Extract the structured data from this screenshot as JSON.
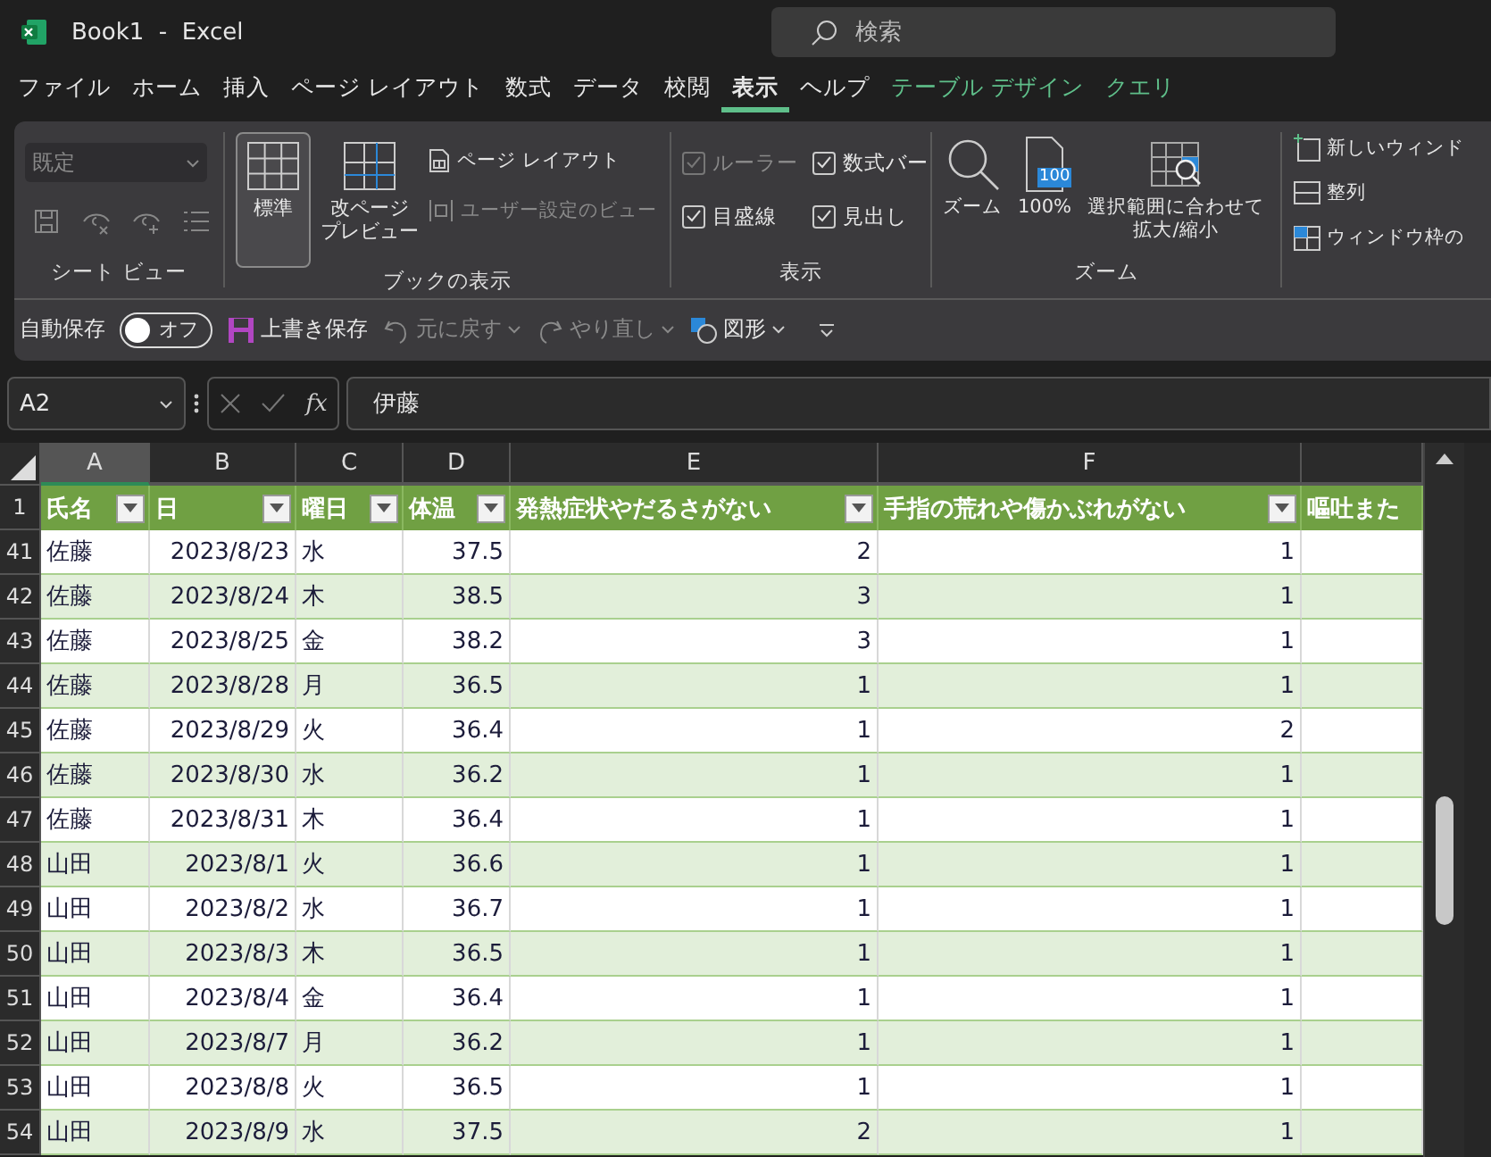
{
  "window": {
    "title": "Book1  -  Excel",
    "search_placeholder": "検索"
  },
  "menu_tabs": [
    {
      "label": "ファイル",
      "selected": false,
      "contextual": false
    },
    {
      "label": "ホーム",
      "selected": false,
      "contextual": false
    },
    {
      "label": "挿入",
      "selected": false,
      "contextual": false
    },
    {
      "label": "ページ レイアウト",
      "selected": false,
      "contextual": false
    },
    {
      "label": "数式",
      "selected": false,
      "contextual": false
    },
    {
      "label": "データ",
      "selected": false,
      "contextual": false
    },
    {
      "label": "校閲",
      "selected": false,
      "contextual": false
    },
    {
      "label": "表示",
      "selected": true,
      "contextual": false
    },
    {
      "label": "ヘルプ",
      "selected": false,
      "contextual": false
    },
    {
      "label": "テーブル デザイン",
      "selected": false,
      "contextual": true
    },
    {
      "label": "クエリ",
      "selected": false,
      "contextual": true
    }
  ],
  "ribbon": {
    "sheet_view": {
      "label": "シート ビュー",
      "dropdown": "既定"
    },
    "workbook_views": {
      "label": "ブックの表示",
      "large": [
        {
          "lines": [
            "標準"
          ],
          "selected": true
        },
        {
          "lines": [
            "改ページ",
            "プレビュー"
          ],
          "selected": false
        }
      ],
      "small": [
        {
          "label": "ページ レイアウト",
          "disabled": false
        },
        {
          "label": "ユーザー設定のビュー",
          "disabled": true
        }
      ]
    },
    "show": {
      "label": "表示",
      "checks": [
        {
          "label": "ルーラー",
          "checked": true,
          "disabled": true
        },
        {
          "label": "数式バー",
          "checked": true,
          "disabled": false
        },
        {
          "label": "目盛線",
          "checked": true,
          "disabled": false
        },
        {
          "label": "見出し",
          "checked": true,
          "disabled": false
        }
      ]
    },
    "zoom": {
      "label": "ズーム",
      "buttons": [
        {
          "kind": "zoom",
          "lines": [
            "ズーム"
          ]
        },
        {
          "kind": "hundred",
          "lines": [
            "100%"
          ],
          "badge": "100"
        },
        {
          "kind": "fit",
          "lines": [
            "選択範囲に合わせて",
            "拡大/縮小"
          ]
        }
      ]
    },
    "window": {
      "items": [
        {
          "kind": "new",
          "label": "新しいウィンド"
        },
        {
          "kind": "arrange",
          "label": "整列"
        },
        {
          "kind": "freeze",
          "label": "ウィンドウ枠の"
        }
      ]
    }
  },
  "quick_access": {
    "autosave_label": "自動保存",
    "autosave": {
      "on": false,
      "label": "オフ"
    },
    "items": [
      {
        "kind": "save",
        "label": "上書き保存",
        "disabled": false
      },
      {
        "kind": "undo",
        "label": "元に戻す",
        "disabled": true
      },
      {
        "kind": "redo",
        "label": "やり直し",
        "disabled": true
      },
      {
        "kind": "shapes",
        "label": "図形",
        "disabled": false
      }
    ]
  },
  "formula_bar": {
    "name_box": "A2",
    "fx_label": "fx",
    "value": "伊藤"
  },
  "sheet": {
    "header_row_num": "1",
    "columns": [
      {
        "letter": "A",
        "header": "氏名",
        "selected": true
      },
      {
        "letter": "B",
        "header": "日",
        "selected": false
      },
      {
        "letter": "C",
        "header": "曜日",
        "selected": false
      },
      {
        "letter": "D",
        "header": "体温",
        "selected": false
      },
      {
        "letter": "E",
        "header": "発熱症状やだるさがない",
        "selected": false
      },
      {
        "letter": "F",
        "header": "手指の荒れや傷かぶれがない",
        "selected": false
      },
      {
        "header": "嘔吐また",
        "selected": false
      }
    ],
    "rows": [
      {
        "num": "41",
        "cells": [
          "佐藤",
          "2023/8/23",
          "水",
          "37.5",
          "2",
          "1"
        ]
      },
      {
        "num": "42",
        "cells": [
          "佐藤",
          "2023/8/24",
          "木",
          "38.5",
          "3",
          "1"
        ]
      },
      {
        "num": "43",
        "cells": [
          "佐藤",
          "2023/8/25",
          "金",
          "38.2",
          "3",
          "1"
        ]
      },
      {
        "num": "44",
        "cells": [
          "佐藤",
          "2023/8/28",
          "月",
          "36.5",
          "1",
          "1"
        ]
      },
      {
        "num": "45",
        "cells": [
          "佐藤",
          "2023/8/29",
          "火",
          "36.4",
          "1",
          "2"
        ]
      },
      {
        "num": "46",
        "cells": [
          "佐藤",
          "2023/8/30",
          "水",
          "36.2",
          "1",
          "1"
        ]
      },
      {
        "num": "47",
        "cells": [
          "佐藤",
          "2023/8/31",
          "木",
          "36.4",
          "1",
          "1"
        ]
      },
      {
        "num": "48",
        "cells": [
          "山田",
          "2023/8/1",
          "火",
          "36.6",
          "1",
          "1"
        ]
      },
      {
        "num": "49",
        "cells": [
          "山田",
          "2023/8/2",
          "水",
          "36.7",
          "1",
          "1"
        ]
      },
      {
        "num": "50",
        "cells": [
          "山田",
          "2023/8/3",
          "木",
          "36.5",
          "1",
          "1"
        ]
      },
      {
        "num": "51",
        "cells": [
          "山田",
          "2023/8/4",
          "金",
          "36.4",
          "1",
          "1"
        ]
      },
      {
        "num": "52",
        "cells": [
          "山田",
          "2023/8/7",
          "月",
          "36.2",
          "1",
          "1"
        ]
      },
      {
        "num": "53",
        "cells": [
          "山田",
          "2023/8/8",
          "火",
          "36.5",
          "1",
          "1"
        ]
      },
      {
        "num": "54",
        "cells": [
          "山田",
          "2023/8/9",
          "水",
          "37.5",
          "2",
          "1"
        ]
      }
    ]
  }
}
